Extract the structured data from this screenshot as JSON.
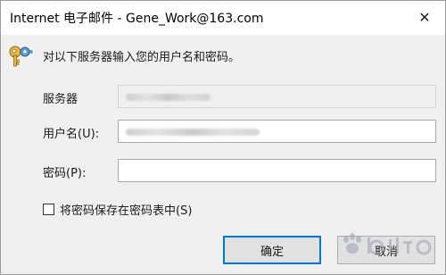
{
  "window": {
    "title": "Internet 电子邮件 - Gene_Work@163.com",
    "close_glyph": "✕"
  },
  "dialog": {
    "prompt": "对以下服务器输入您的用户名和密码。",
    "server_label": "服务器",
    "username_label": "用户名(U):",
    "password_label": "密码(P):",
    "remember_label": "将密码保存在密码表中(S)",
    "remember_checked": false,
    "ok_label": "确定",
    "cancel_label": "取消"
  },
  "icons": {
    "key": "key-icon",
    "close": "close-icon"
  },
  "colors": {
    "accent": "#0078d7",
    "body_bg": "#f0f0f0"
  }
}
